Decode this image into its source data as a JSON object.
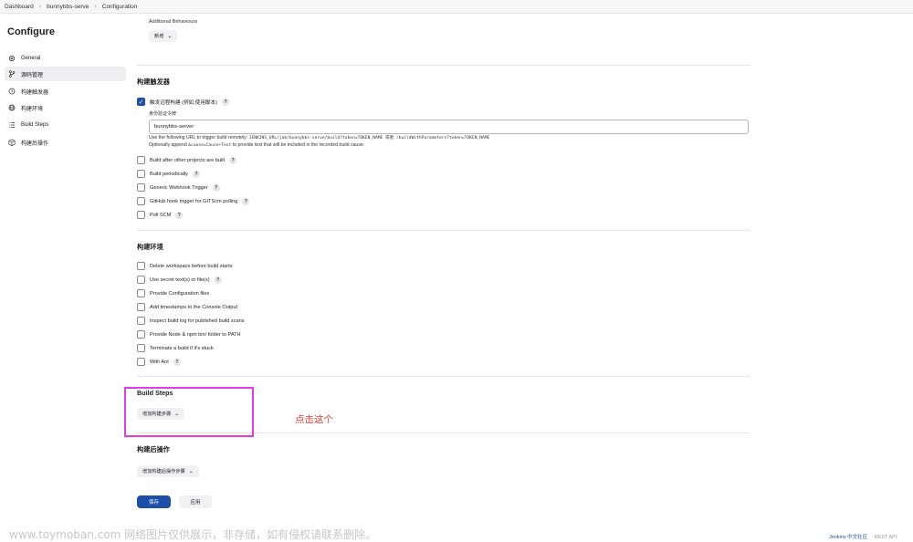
{
  "breadcrumb": [
    "Dashboard",
    "bunnybbs-serve",
    "Configuration"
  ],
  "sidebar": {
    "title": "Configure",
    "items": [
      {
        "label": "General",
        "icon": "gear-icon"
      },
      {
        "label": "源码管理",
        "icon": "branch-icon"
      },
      {
        "label": "构建触发器",
        "icon": "clock-icon"
      },
      {
        "label": "构建环境",
        "icon": "globe-icon"
      },
      {
        "label": "Build Steps",
        "icon": "list-icon"
      },
      {
        "label": "构建后操作",
        "icon": "box-icon"
      }
    ]
  },
  "scm": {
    "additional_behaviours": "Additional Behaviours",
    "add_button": "新增"
  },
  "triggers": {
    "title": "构建触发器",
    "remote_label": "触发远程构建 (例如,使用脚本)",
    "token_label": "身份验证令牌",
    "token_value": "bunnybbs-server",
    "hint_1a": "Use the following URL to trigger build remotely:",
    "hint_1b": "JENKINS_URL/job/bunnybbs-serve/build?token=TOKEN_NAME 或者 /buildWithParameters?token=TOKEN_NAME",
    "hint_2a": "Optionally append",
    "hint_2b": "&cause=Cause+Text",
    "hint_2c": "to provide text that will be included in the recorded build cause.",
    "options": [
      "Build after other projects are built",
      "Build periodically",
      "Generic Webhook Trigger",
      "GitHub hook trigger for GITScm polling",
      "Poll SCM"
    ]
  },
  "environment": {
    "title": "构建环境",
    "options": [
      "Delete workspace before build starts",
      "Use secret text(s) or file(s)",
      "Provide Configuration files",
      "Add timestamps to the Console Output",
      "Inspect build log for published build scans",
      "Provide Node & npm bin/ folder to PATH",
      "Terminate a build if it's stuck",
      "With Ant"
    ]
  },
  "build_steps": {
    "title": "Build Steps",
    "add_button": "增加构建步骤"
  },
  "post_build": {
    "title": "构建后操作",
    "add_button": "增加构建后操作步骤"
  },
  "annotation": "点击这个",
  "actions": {
    "save": "保存",
    "apply": "应用"
  },
  "watermark": "www.toymoban.com 网络图片仅供展示，非存储，如有侵权请联系删除。",
  "footer": {
    "link": "Jenkins 中文社区",
    "version": "REST API"
  },
  "colors": {
    "primary": "#1e4fa8",
    "highlight": "#e838e8",
    "annotation": "#e53935"
  }
}
